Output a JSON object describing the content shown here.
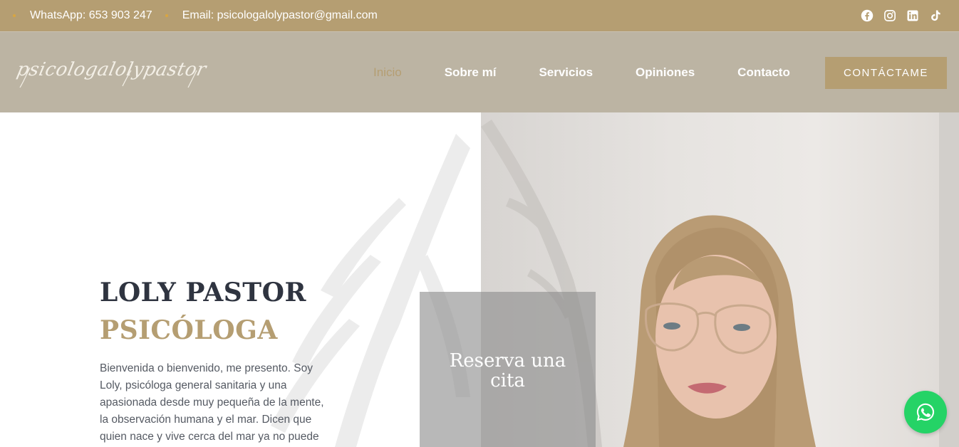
{
  "topbar": {
    "whatsapp": "WhatsApp: 653 903 247",
    "email": "Email: psicologalolypastor@gmail.com",
    "social_icons": [
      "facebook-icon",
      "instagram-icon",
      "linkedin-icon",
      "tiktok-icon"
    ]
  },
  "header": {
    "logo_text": "psicologalolypastor",
    "nav": [
      "Inicio",
      "Sobre mí",
      "Servicios",
      "Opiniones",
      "Contacto"
    ],
    "active_nav": "Inicio",
    "cta_label": "CONTÁCTAME"
  },
  "hero": {
    "name": "LOLY PASTOR",
    "role": "PSICÓLOGA",
    "intro": "Bienvenida o bienvenido, me presento. Soy Loly, psicóloga general sanitaria y una apasionada desde muy pequeña de la mente, la observación humana y el mar. Dicen que quien nace y vive cerca del mar ya no puede vivir sin",
    "book_label": "Reserva una cita"
  },
  "colors": {
    "accent": "#b59e72",
    "header_bg": "#bcb4a3",
    "whatsapp": "#25d366",
    "dark_text": "#2f3440"
  }
}
